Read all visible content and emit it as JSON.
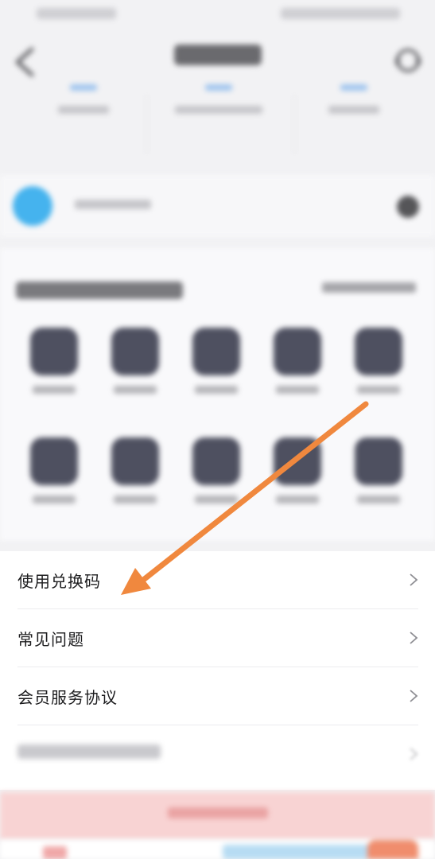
{
  "header": {
    "title": "????"
  },
  "menu": {
    "items": [
      {
        "label": "使用兑换码"
      },
      {
        "label": "常见问题"
      },
      {
        "label": "会员服务协议"
      }
    ]
  },
  "annotation": {
    "arrow_color": "#f0883e"
  },
  "colors": {
    "background": "#f2f2f4",
    "accent": "#45b3ee",
    "cta_bg": "#f8d3d3"
  }
}
